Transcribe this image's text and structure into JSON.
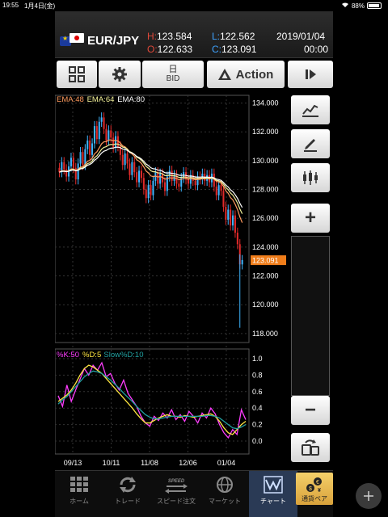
{
  "status_bar": {
    "time": "19:55",
    "date": "1月4日(金)",
    "battery": "88%"
  },
  "header": {
    "pair": "EUR/JPY",
    "high_label": "H:",
    "high": "123.584",
    "open_label": "O:",
    "open": "122.633",
    "low_label": "L:",
    "low": "122.562",
    "close_label": "C:",
    "close": "123.091",
    "date": "2019/01/04",
    "time": "00:00"
  },
  "toolbar": {
    "period_label": "日",
    "price_type": "BID",
    "action_label": "Action"
  },
  "chart_data": [
    {
      "type": "candlestick",
      "legend": [
        {
          "name": "EMA:48",
          "color": "#ff9b5e"
        },
        {
          "name": "EMA:64",
          "color": "#f4f29a"
        },
        {
          "name": "EMA:80",
          "color": "#ffffff"
        }
      ],
      "y_ticks": [
        "134.000",
        "132.000",
        "130.000",
        "128.000",
        "126.000",
        "124.000",
        "122.000",
        "120.000",
        "118.000"
      ],
      "ylim": [
        117.6,
        134.2
      ],
      "x_ticks": [
        "09/13",
        "10/11",
        "11/08",
        "12/06",
        "01/04"
      ],
      "current_price": "123.091",
      "up_color": "#3fb6ff",
      "down_color": "#e02a2a",
      "closes": [
        129.2,
        129.9,
        129.4,
        128.9,
        129.6,
        130.2,
        129.5,
        128.7,
        129.8,
        130.6,
        129.7,
        130.8,
        131.4,
        130.4,
        131.2,
        132.4,
        131.5,
        132.7,
        133.0,
        132.2,
        131.4,
        132.1,
        131.6,
        130.9,
        131.7,
        131.0,
        130.4,
        129.7,
        130.5,
        129.8,
        129.0,
        129.9,
        129.2,
        128.5,
        129.3,
        128.8,
        128.0,
        127.4,
        128.3,
        127.6,
        128.6,
        129.2,
        128.4,
        129.1,
        128.5,
        127.9,
        128.9,
        129.3,
        128.6,
        129.0,
        128.4,
        128.2,
        128.8,
        129.2,
        128.7,
        128.4,
        129.0,
        128.6,
        128.3,
        128.9,
        128.7,
        129.1,
        128.6,
        129.0,
        128.5,
        129.1,
        128.2,
        127.6,
        128.3,
        127.9,
        126.8,
        125.9,
        126.6,
        125.5,
        126.2,
        125.0,
        124.2,
        122.8,
        123.1
      ]
    },
    {
      "type": "line",
      "legend": [
        {
          "name": "%K:50",
          "color": "#ff3dff"
        },
        {
          "name": "%D:5",
          "color": "#ffe640"
        },
        {
          "name": "Slow%D:10",
          "color": "#20a0a0"
        }
      ],
      "y_ticks": [
        "1.0",
        "0.8",
        "0.6",
        "0.4",
        "0.2",
        "0.0"
      ],
      "ylim": [
        0.0,
        1.0
      ],
      "series": [
        {
          "name": "%K:50",
          "values": [
            0.55,
            0.42,
            0.68,
            0.48,
            0.62,
            0.75,
            0.88,
            0.8,
            0.92,
            0.86,
            0.95,
            0.78,
            0.82,
            0.7,
            0.62,
            0.74,
            0.58,
            0.5,
            0.42,
            0.3,
            0.22,
            0.18,
            0.3,
            0.25,
            0.34,
            0.28,
            0.38,
            0.26,
            0.32,
            0.24,
            0.36,
            0.3,
            0.22,
            0.34,
            0.28,
            0.4,
            0.33,
            0.2,
            0.1,
            0.04,
            0.14,
            0.08,
            0.38,
            0.26
          ]
        },
        {
          "name": "%D:5",
          "values": [
            0.48,
            0.52,
            0.56,
            0.62,
            0.7,
            0.8,
            0.88,
            0.92,
            0.9,
            0.86,
            0.82,
            0.76,
            0.7,
            0.64,
            0.58,
            0.52,
            0.46,
            0.4,
            0.33,
            0.27,
            0.22,
            0.22,
            0.25,
            0.28,
            0.3,
            0.32,
            0.3,
            0.3,
            0.29,
            0.31,
            0.3,
            0.29,
            0.3,
            0.31,
            0.32,
            0.33,
            0.3,
            0.24,
            0.16,
            0.1,
            0.08,
            0.14,
            0.2,
            0.24
          ]
        },
        {
          "name": "Slow%D:10",
          "values": [
            0.45,
            0.5,
            0.54,
            0.6,
            0.66,
            0.72,
            0.78,
            0.82,
            0.85,
            0.84,
            0.82,
            0.78,
            0.74,
            0.69,
            0.64,
            0.58,
            0.53,
            0.48,
            0.42,
            0.37,
            0.32,
            0.29,
            0.27,
            0.27,
            0.28,
            0.29,
            0.3,
            0.3,
            0.3,
            0.3,
            0.3,
            0.3,
            0.3,
            0.3,
            0.31,
            0.31,
            0.3,
            0.28,
            0.24,
            0.2,
            0.16,
            0.15,
            0.17,
            0.2
          ]
        }
      ]
    }
  ],
  "sidebar": {
    "zoom_in": "+",
    "zoom_out": "−"
  },
  "tabs": [
    {
      "label": "ホーム"
    },
    {
      "label": "トレード"
    },
    {
      "label": "スピード注文",
      "badge": "SPEED"
    },
    {
      "label": "マーケット"
    },
    {
      "label": "チャート"
    }
  ],
  "currency_pair_tab": {
    "label": "通貨ペア"
  }
}
